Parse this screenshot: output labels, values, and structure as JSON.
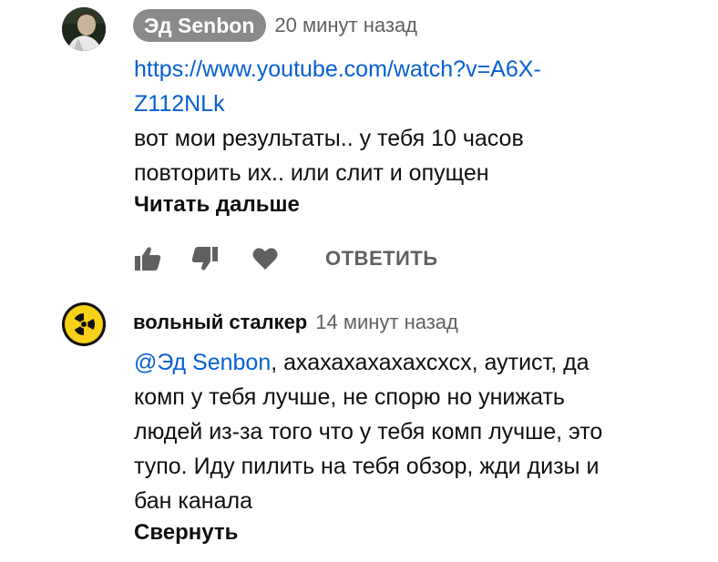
{
  "comments": [
    {
      "author": "Эд Senbon",
      "time": "20 минут назад",
      "link_line1": "https://www.youtube.com/watch?v=A6X-",
      "link_line2": "Z112NLk",
      "text_line1": "вот мои результаты.. у тебя 10 часов",
      "text_line2": "повторить их.. или слит и опущен",
      "more_label": "Читать дальше",
      "reply_label": "ОТВЕТИТЬ",
      "icons": [
        "thumbs-up-icon",
        "thumbs-down-icon",
        "heart-icon"
      ]
    },
    {
      "author": "вольный сталкер",
      "time": "14 минут назад",
      "mention": "@Эд Senbon",
      "text_line1_rest": ", ахахахахахахсхсх, аутист, да",
      "text_line2": "комп у тебя лучше, не спорю но унижать",
      "text_line3": "людей из-за того что у тебя комп лучше, это",
      "text_line4": "тупо. Иду пилить на тебя обзор, жди дизы и",
      "text_line5": "бан канала",
      "collapse_label": "Свернуть",
      "avatar_icon": "radiation-icon"
    }
  ],
  "colors": {
    "link": "#065fd4",
    "secondary_text": "#606060",
    "author_badge_bg": "#8a8a8a",
    "radiation_yellow": "#f7d117"
  }
}
